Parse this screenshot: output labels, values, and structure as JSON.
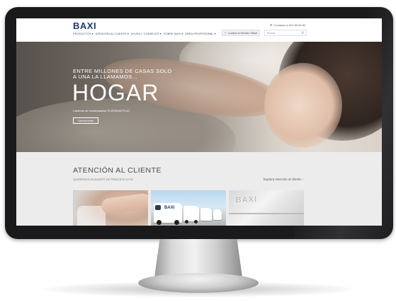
{
  "header": {
    "logo": "BAXI",
    "nav": [
      "PRODUCTOS ▾",
      "ATENCIÓN AL CLIENTE ▾",
      "AYUDA Y CONSEJOS ▾",
      "SOBRE BAXI ▾",
      "ÁREA PROFESIONAL ▾"
    ],
    "contact": "Contacta tu 902 89 80 80",
    "tech_button": "Localiza tu Servicio Oficial",
    "search_placeholder": "Buscar..."
  },
  "hero": {
    "pretitle_line1": "ENTRE MILLONES DE CASAS SOLO",
    "pretitle_line2": "A UNA LA LLAMAMOS...",
    "title": "HOGAR",
    "subtitle": "Calderas de condensación PLATINUM PLUS",
    "button": "Descúbrelas"
  },
  "attention": {
    "title": "ATENCIÓN AL CLIENTE",
    "subtitle": "QUEREMOS AYUDARTE DE PRINCIPIO A FIN",
    "link": "Explora Atención al cliente  ›",
    "van_label": "BAXI",
    "boiler_label": "BAXI"
  }
}
